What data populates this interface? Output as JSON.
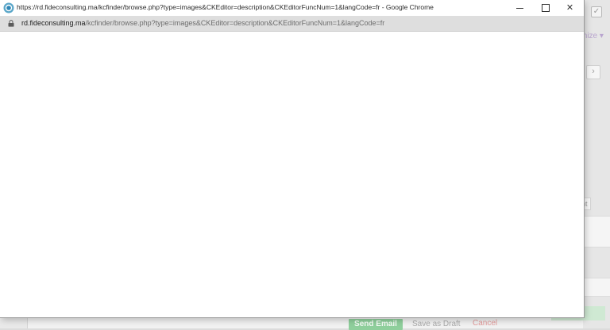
{
  "window": {
    "title": "https://rd.fideconsulting.ma/kcfinder/browse.php?type=images&CKEditor=description&CKEditorFuncNum=1&langCode=fr - Google Chrome",
    "minimize_icon": "minimize-icon",
    "maximize_icon": "maximize-icon",
    "close_icon": "close-icon",
    "close_glyph": "✕"
  },
  "address": {
    "host": "rd.fideconsulting.ma",
    "path": "/kcfinder/browse.php?type=images&CKEditor=description&CKEditorFuncNum=1&langCode=fr",
    "icon": "lock-icon"
  },
  "background": {
    "customize_label": "mize ▾",
    "arrow_label": "›",
    "attachment_label": "ent",
    "send_label": "Send Email",
    "draft_label": "Save as Draft",
    "cancel_label": "Cancel",
    "check_glyph": "✓"
  },
  "colors": {
    "send_green": "#8fcf9c",
    "cancel_red": "#e39a9a",
    "accent_purple": "#b9a4cf"
  }
}
